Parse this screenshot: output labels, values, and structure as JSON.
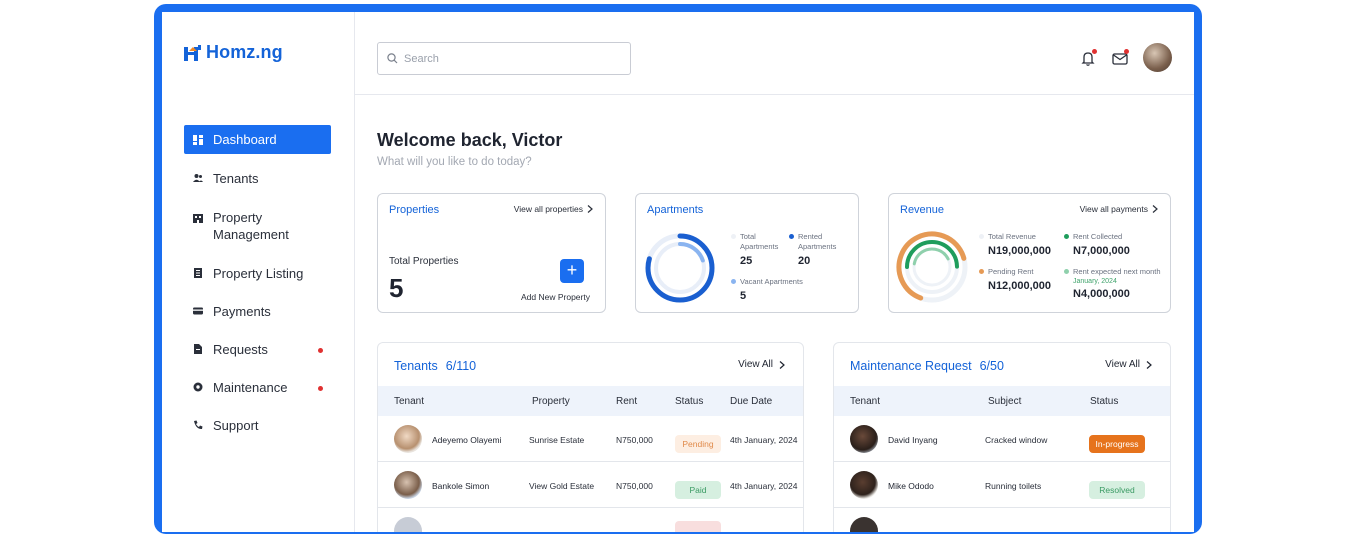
{
  "app": {
    "logo": "Homz.ng"
  },
  "colors": {
    "primary": "#1a6ef0",
    "link": "#1463d8",
    "alert": "#e03131",
    "orange": "#e6731c",
    "green": "#3a9a63"
  },
  "sidebar": {
    "items": [
      {
        "label": "Dashboard",
        "icon": "dashboard-icon",
        "active": true
      },
      {
        "label": "Tenants",
        "icon": "users-icon"
      },
      {
        "label": "Property Management",
        "icon": "building-icon"
      },
      {
        "label": "Property Listing",
        "icon": "list-icon"
      },
      {
        "label": "Payments",
        "icon": "card-icon"
      },
      {
        "label": "Requests",
        "icon": "file-icon",
        "badge_dot": true
      },
      {
        "label": "Maintenance",
        "icon": "gear-icon",
        "badge_dot": true
      },
      {
        "label": "Support",
        "icon": "phone-icon"
      }
    ]
  },
  "topbar": {
    "search_placeholder": "Search"
  },
  "welcome": {
    "title": "Welcome back, Victor",
    "subtitle": "What will you like to do today?"
  },
  "properties_card": {
    "title": "Properties",
    "link": "View all properties",
    "label": "Total Properties",
    "value": "5",
    "add_label": "Add New Property"
  },
  "apartments_card": {
    "title": "Apartments",
    "total_label": "Total Apartments",
    "total_value": "25",
    "rented_label": "Rented Apartments",
    "rented_value": "20",
    "vacant_label": "Vacant Apartments",
    "vacant_value": "5"
  },
  "revenue_card": {
    "title": "Revenue",
    "link": "View all payments",
    "total_label": "Total Revenue",
    "total_value": "N19,000,000",
    "collected_label": "Rent Collected",
    "collected_value": "N7,000,000",
    "pending_label": "Pending Rent",
    "pending_value": "N12,000,000",
    "expected_label": "Rent expected next month",
    "expected_date": "January, 2024",
    "expected_value": "N4,000,000"
  },
  "tenants_table": {
    "title": "Tenants",
    "count": "6/110",
    "view_all": "View All",
    "headers": [
      "Tenant",
      "Property",
      "Rent",
      "Status",
      "Due Date"
    ],
    "rows": [
      {
        "tenant": "Adeyemo Olayemi",
        "property": "Sunrise Estate",
        "rent": "N750,000",
        "status": "Pending",
        "due": "4th January, 2024"
      },
      {
        "tenant": "Bankole Simon",
        "property": "View Gold Estate",
        "rent": "N750,000",
        "status": "Paid",
        "due": "4th January, 2024"
      }
    ]
  },
  "maintenance_table": {
    "title": "Maintenance Request",
    "count": "6/50",
    "view_all": "View All",
    "headers": [
      "Tenant",
      "Subject",
      "Status"
    ],
    "rows": [
      {
        "tenant": "David Inyang",
        "subject": "Cracked window",
        "status": "In-progress"
      },
      {
        "tenant": "Mike Ododo",
        "subject": "Running toilets",
        "status": "Resolved"
      }
    ]
  }
}
